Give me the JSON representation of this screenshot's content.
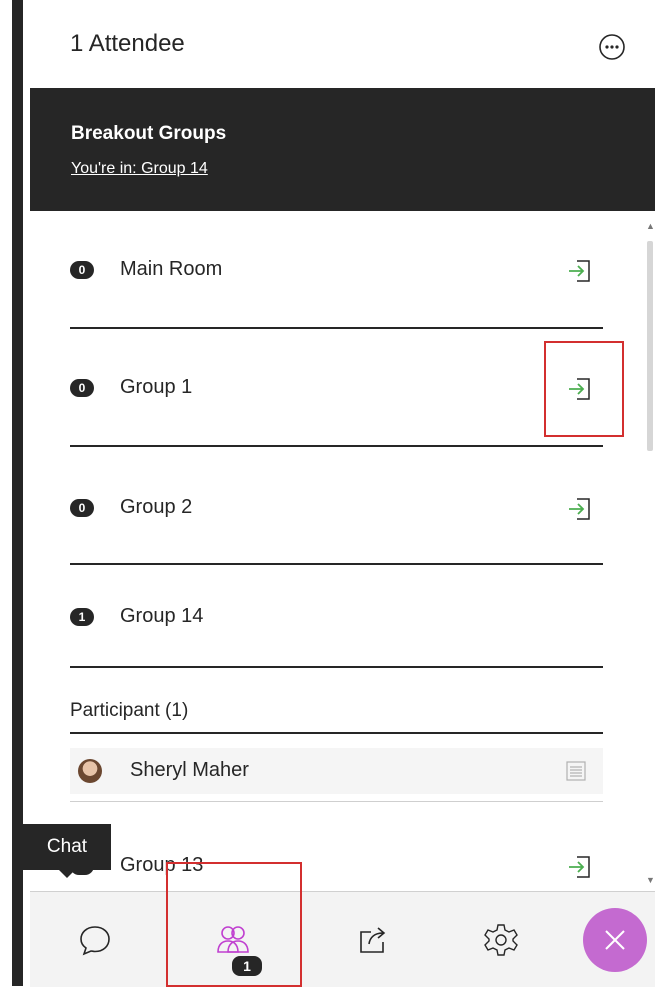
{
  "header": {
    "title": "1 Attendee",
    "more_icon": "more-options-icon"
  },
  "banner": {
    "title": "Breakout Groups",
    "current_group_link": "You're in: Group 14"
  },
  "groups": [
    {
      "name": "Main Room",
      "count": "0",
      "join_icon": "join-group-icon"
    },
    {
      "name": "Group 1",
      "count": "0",
      "join_icon": "join-group-icon"
    },
    {
      "name": "Group 2",
      "count": "0",
      "join_icon": "join-group-icon"
    },
    {
      "name": "Group 14",
      "count": "1"
    },
    {
      "name": "Group 13",
      "count": "0",
      "join_icon": "join-group-icon"
    }
  ],
  "participants": {
    "title": "Participant (1)",
    "items": [
      {
        "name": "Sheryl Maher"
      }
    ]
  },
  "tooltip": {
    "text": "Chat"
  },
  "bottom_bar": {
    "attendees_count": "1",
    "icons": [
      "chat-icon",
      "attendees-icon",
      "share-content-icon",
      "settings-icon",
      "close-panel-icon"
    ]
  },
  "colors": {
    "dark": "#262626",
    "join_green": "#4caf50",
    "close_purple": "#c46ad0",
    "highlight_red": "#d32f2f"
  }
}
